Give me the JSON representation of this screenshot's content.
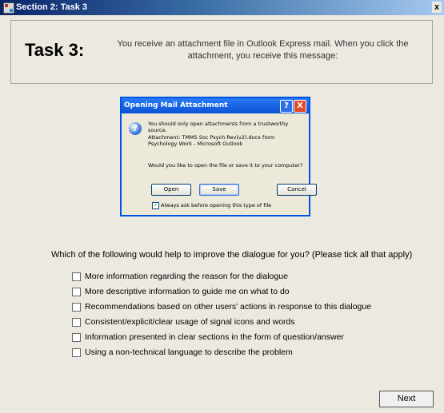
{
  "window": {
    "title": "Section 2: Task 3",
    "close_glyph": "x"
  },
  "header": {
    "task_label": "Task 3:",
    "description": "You receive an attachment file in Outlook Express mail.  When you click the attachment, you receive this message:"
  },
  "dialog": {
    "title": "Opening Mail Attachment",
    "help_glyph": "?",
    "close_glyph": "X",
    "warning": "You should only open attachments from a trustworthy source.",
    "attachment_info": "Attachment: TMMS Soc Psych Rev(v2).docx from Psychology Work - Microsoft Outlook",
    "prompt": "Would you like to open the file or save it to your computer?",
    "buttons": {
      "open": "Open",
      "save": "Save",
      "cancel": "Cancel"
    },
    "always_ask": "Always ask before opening this type of file",
    "always_ask_checked": true
  },
  "question": "Which of the following would help to improve the dialogue for you? (Please tick all that apply)",
  "options": [
    "More information regarding the reason for the dialogue",
    "More descriptive information to guide me on what to do",
    "Recommendations based on other users' actions in response to this dialogue",
    "Consistent/explicit/clear usage of signal icons and words",
    "Information presented in clear sections in the form of question/answer",
    "Using a non-technical language to describe the problem"
  ],
  "next_button": "Next"
}
